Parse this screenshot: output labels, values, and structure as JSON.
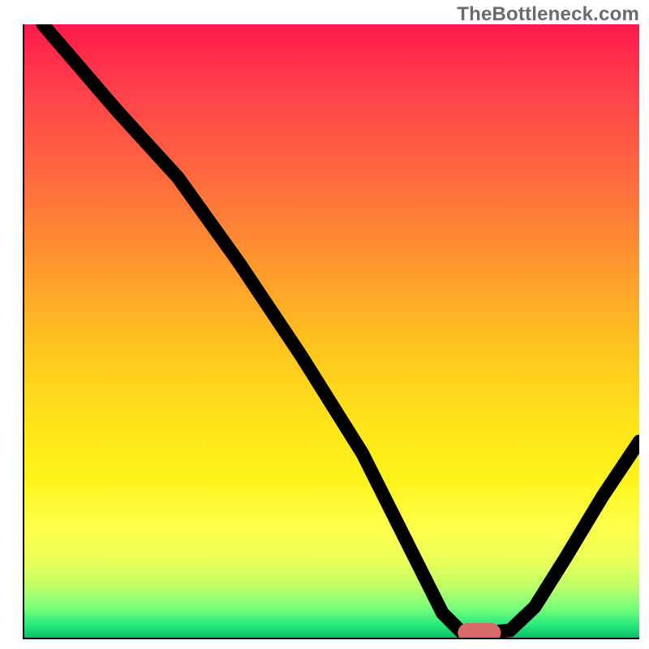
{
  "watermark": "TheBottleneck.com",
  "chart_data": {
    "type": "line",
    "title": "",
    "xlabel": "",
    "ylabel": "",
    "xlim": [
      0,
      100
    ],
    "ylim": [
      0,
      100
    ],
    "background": "rainbow-vertical",
    "curve_points": [
      {
        "x": 3,
        "y": 100
      },
      {
        "x": 15,
        "y": 86
      },
      {
        "x": 25,
        "y": 75
      },
      {
        "x": 35,
        "y": 61
      },
      {
        "x": 45,
        "y": 46
      },
      {
        "x": 55,
        "y": 30
      },
      {
        "x": 63,
        "y": 14
      },
      {
        "x": 68,
        "y": 4
      },
      {
        "x": 71,
        "y": 1
      },
      {
        "x": 75,
        "y": 0.8
      },
      {
        "x": 79,
        "y": 1.2
      },
      {
        "x": 83,
        "y": 5
      },
      {
        "x": 88,
        "y": 13
      },
      {
        "x": 94,
        "y": 23
      },
      {
        "x": 100,
        "y": 32
      }
    ],
    "marker": {
      "x": 74,
      "y": 0.8,
      "width": 6,
      "color": "#d96a6a"
    }
  }
}
